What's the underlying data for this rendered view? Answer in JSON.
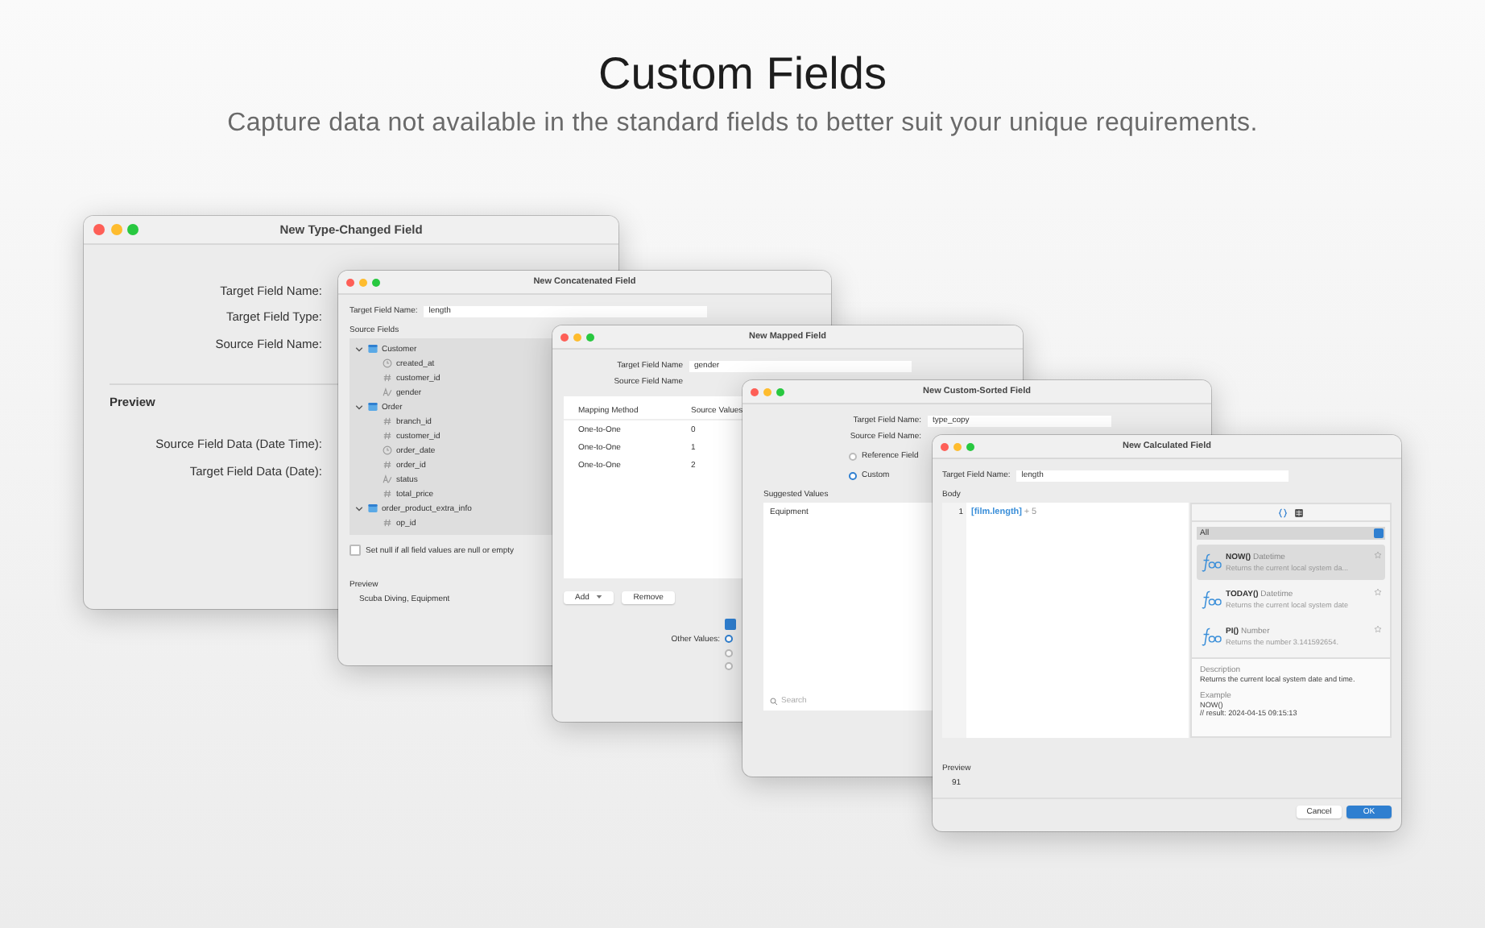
{
  "header": {
    "title": "Custom Fields",
    "subtitle": "Capture data not available in the standard fields to better suit your unique requirements."
  },
  "windows": [
    {
      "kind": "type_changed",
      "title": "New Type-Changed Field",
      "fields": [
        {
          "label": "Target Field Name:"
        },
        {
          "label": "Target Field Type:"
        },
        {
          "label": "Source Field Name:"
        }
      ],
      "preview_heading": "Preview",
      "preview_rows": [
        {
          "label": "Source Field Data (Date Time):"
        },
        {
          "label": "Target Field Data (Date):"
        }
      ]
    },
    {
      "kind": "concatenated",
      "title": "New Concatenated Field",
      "target_label": "Target Field Name:",
      "target_value": "length",
      "source_heading": "Source Fields",
      "tree": [
        {
          "label": "Customer",
          "kind": "table",
          "expanded": true,
          "children": [
            {
              "label": "created_at",
              "kind": "datetime"
            },
            {
              "label": "customer_id",
              "kind": "number"
            },
            {
              "label": "gender",
              "kind": "text"
            }
          ]
        },
        {
          "label": "Order",
          "kind": "table",
          "expanded": true,
          "children": [
            {
              "label": "branch_id",
              "kind": "number"
            },
            {
              "label": "customer_id",
              "kind": "number"
            },
            {
              "label": "order_date",
              "kind": "datetime"
            },
            {
              "label": "order_id",
              "kind": "number"
            },
            {
              "label": "status",
              "kind": "text"
            },
            {
              "label": "total_price",
              "kind": "number"
            }
          ]
        },
        {
          "label": "order_product_extra_info",
          "kind": "table",
          "expanded": true,
          "children": [
            {
              "label": "op_id",
              "kind": "number"
            }
          ]
        }
      ],
      "set_null": {
        "label": "Set null if all field values are null or empty",
        "checked": false
      },
      "preview_heading": "Preview",
      "preview_value": "Scuba Diving, Equipment"
    },
    {
      "kind": "mapped",
      "title": "New Mapped Field",
      "target_label": "Target Field Name",
      "target_value": "gender",
      "source_label": "Source Field Name",
      "columns": [
        "Mapping Method",
        "Source Values"
      ],
      "rows": [
        [
          "One-to-One",
          "0"
        ],
        [
          "One-to-One",
          "1"
        ],
        [
          "One-to-One",
          "2"
        ]
      ],
      "add_button": "Add",
      "remove_button": "Remove",
      "option": {
        "checked": true
      },
      "other_values_label": "Other Values:",
      "other_values": [
        {
          "selected": true
        },
        {
          "selected": false
        },
        {
          "selected": false
        }
      ]
    },
    {
      "kind": "custom_sorted",
      "title": "New Custom-Sorted Field",
      "target_label": "Target Field Name:",
      "target_value": "type_copy",
      "source_label": "Source Field Name:",
      "modes": [
        {
          "label": "Reference Field",
          "selected": false
        },
        {
          "label": "Custom",
          "selected": true
        }
      ],
      "suggested_heading": "Suggested Values",
      "suggested": [
        "Equipment"
      ],
      "search_placeholder": "Search"
    },
    {
      "kind": "calculated",
      "title": "New Calculated Field",
      "target_label": "Target Field Name:",
      "target_value": "length",
      "body_heading": "Body",
      "code_lines": [
        {
          "number": "1",
          "tokens": [
            {
              "text": "[film.length]",
              "kind": "field"
            },
            {
              "text": "+",
              "kind": "operator"
            },
            {
              "text": "5",
              "kind": "number"
            }
          ]
        }
      ],
      "panel_tabs": [
        {
          "kind": "braces",
          "selected": true
        },
        {
          "kind": "table",
          "selected": false
        }
      ],
      "category": "All",
      "functions": [
        {
          "name": "NOW()",
          "type": "Datetime",
          "summary": "Returns the current local system da...",
          "selected": true
        },
        {
          "name": "TODAY()",
          "type": "Datetime",
          "summary": "Returns the current local system date",
          "selected": false
        },
        {
          "name": "PI()",
          "type": "Number",
          "summary": "Returns the number 3.141592654.",
          "selected": false
        }
      ],
      "description_heading": "Description",
      "description": "Returns the current local system date and time.",
      "example_heading": "Example",
      "example_lines": [
        "NOW()",
        "// result: 2024-04-15 09:15:13"
      ],
      "preview_heading": "Preview",
      "preview_value": "91",
      "cancel_button": "Cancel",
      "ok_button": "OK"
    }
  ]
}
